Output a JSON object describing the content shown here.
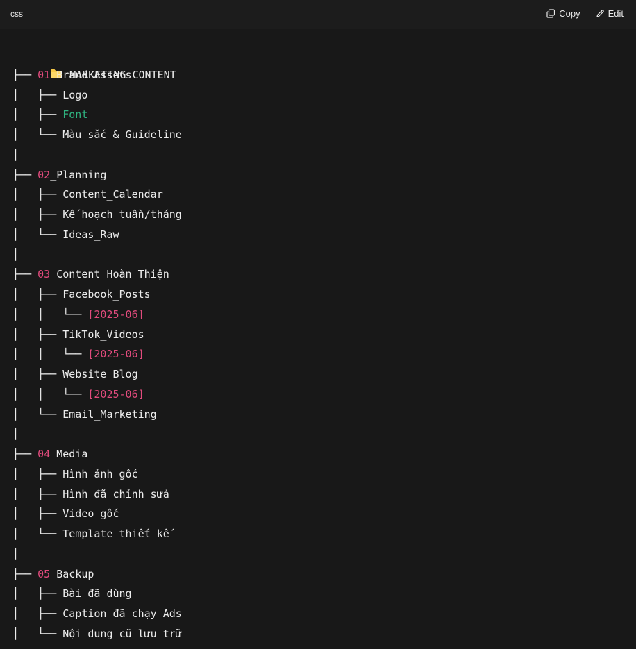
{
  "header": {
    "language": "css",
    "copy_label": "Copy",
    "edit_label": "Edit"
  },
  "tree": {
    "root_icon": "folder-icon",
    "root": "MARKETING_CONTENT",
    "lines": [
      {
        "prefix": "├── ",
        "num": "01",
        "rest": "_Brand_Assets",
        "type": "folder"
      },
      {
        "prefix": "│   ├── ",
        "rest": "Logo",
        "type": "plain"
      },
      {
        "prefix": "│   ├── ",
        "rest": "Font",
        "type": "green"
      },
      {
        "prefix": "│   └── ",
        "rest": "Màu sắc & Guideline",
        "type": "plain"
      },
      {
        "prefix": "│",
        "rest": "",
        "type": "plain"
      },
      {
        "prefix": "├── ",
        "num": "02",
        "rest": "_Planning",
        "type": "folder"
      },
      {
        "prefix": "│   ├── ",
        "rest": "Content_Calendar",
        "type": "plain"
      },
      {
        "prefix": "│   ├── ",
        "rest": "Kế hoạch tuần/tháng",
        "type": "plain"
      },
      {
        "prefix": "│   └── ",
        "rest": "Ideas_Raw",
        "type": "plain"
      },
      {
        "prefix": "│",
        "rest": "",
        "type": "plain"
      },
      {
        "prefix": "├── ",
        "num": "03",
        "rest": "_Content_Hoàn_Thiện",
        "type": "folder"
      },
      {
        "prefix": "│   ├── ",
        "rest": "Facebook_Posts",
        "type": "plain"
      },
      {
        "prefix": "│   │   └── ",
        "rest": "[2025-06]",
        "type": "pink"
      },
      {
        "prefix": "│   ├── ",
        "rest": "TikTok_Videos",
        "type": "plain"
      },
      {
        "prefix": "│   │   └── ",
        "rest": "[2025-06]",
        "type": "pink"
      },
      {
        "prefix": "│   ├── ",
        "rest": "Website_Blog",
        "type": "plain"
      },
      {
        "prefix": "│   │   └── ",
        "rest": "[2025-06]",
        "type": "pink"
      },
      {
        "prefix": "│   └── ",
        "rest": "Email_Marketing",
        "type": "plain"
      },
      {
        "prefix": "│",
        "rest": "",
        "type": "plain"
      },
      {
        "prefix": "├── ",
        "num": "04",
        "rest": "_Media",
        "type": "folder"
      },
      {
        "prefix": "│   ├── ",
        "rest": "Hình ảnh gốc",
        "type": "plain"
      },
      {
        "prefix": "│   ├── ",
        "rest": "Hình đã chỉnh sửa",
        "type": "plain"
      },
      {
        "prefix": "│   ├── ",
        "rest": "Video gốc",
        "type": "plain"
      },
      {
        "prefix": "│   └── ",
        "rest": "Template thiết kế",
        "type": "plain"
      },
      {
        "prefix": "│",
        "rest": "",
        "type": "plain"
      },
      {
        "prefix": "├── ",
        "num": "05",
        "rest": "_Backup",
        "type": "folder"
      },
      {
        "prefix": "│   ├── ",
        "rest": "Bài đã dùng",
        "type": "plain"
      },
      {
        "prefix": "│   ├── ",
        "rest": "Caption đã chạy Ads",
        "type": "plain"
      },
      {
        "prefix": "│   └── ",
        "rest": "Nội dung cũ lưu trữ",
        "type": "plain"
      }
    ]
  }
}
